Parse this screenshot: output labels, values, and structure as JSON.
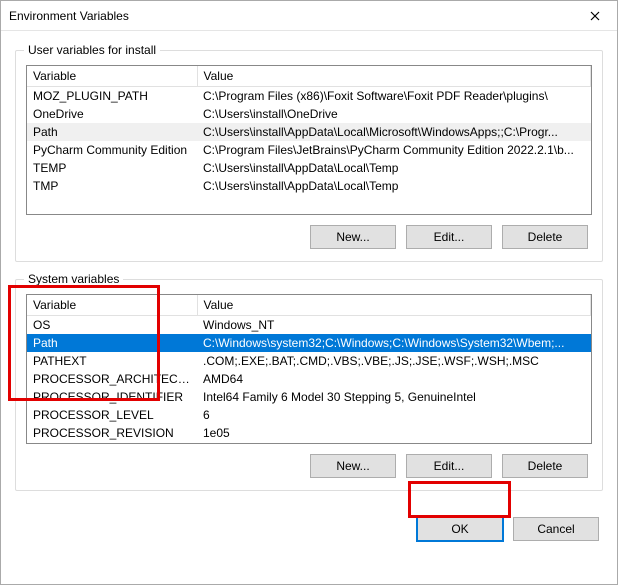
{
  "window": {
    "title": "Environment Variables"
  },
  "userGroup": {
    "legend": "User variables for install",
    "columns": {
      "variable": "Variable",
      "value": "Value"
    },
    "rows": [
      {
        "variable": "MOZ_PLUGIN_PATH",
        "value": "C:\\Program Files (x86)\\Foxit Software\\Foxit PDF Reader\\plugins\\"
      },
      {
        "variable": "OneDrive",
        "value": "C:\\Users\\install\\OneDrive"
      },
      {
        "variable": "Path",
        "value": "C:\\Users\\install\\AppData\\Local\\Microsoft\\WindowsApps;;C:\\Progr...",
        "selected": true
      },
      {
        "variable": "PyCharm Community Edition",
        "value": "C:\\Program Files\\JetBrains\\PyCharm Community Edition 2022.2.1\\b..."
      },
      {
        "variable": "TEMP",
        "value": "C:\\Users\\install\\AppData\\Local\\Temp"
      },
      {
        "variable": "TMP",
        "value": "C:\\Users\\install\\AppData\\Local\\Temp"
      }
    ],
    "buttons": {
      "new": "New...",
      "edit": "Edit...",
      "delete": "Delete"
    }
  },
  "systemGroup": {
    "legend": "System variables",
    "columns": {
      "variable": "Variable",
      "value": "Value"
    },
    "rows": [
      {
        "variable": "OS",
        "value": "Windows_NT"
      },
      {
        "variable": "Path",
        "value": "C:\\Windows\\system32;C:\\Windows;C:\\Windows\\System32\\Wbem;...",
        "selected": true
      },
      {
        "variable": "PATHEXT",
        "value": ".COM;.EXE;.BAT;.CMD;.VBS;.VBE;.JS;.JSE;.WSF;.WSH;.MSC"
      },
      {
        "variable": "PROCESSOR_ARCHITECTURE",
        "value": "AMD64"
      },
      {
        "variable": "PROCESSOR_IDENTIFIER",
        "value": "Intel64 Family 6 Model 30 Stepping 5, GenuineIntel"
      },
      {
        "variable": "PROCESSOR_LEVEL",
        "value": "6"
      },
      {
        "variable": "PROCESSOR_REVISION",
        "value": "1e05"
      }
    ],
    "buttons": {
      "new": "New...",
      "edit": "Edit...",
      "delete": "Delete"
    }
  },
  "dialogButtons": {
    "ok": "OK",
    "cancel": "Cancel"
  }
}
